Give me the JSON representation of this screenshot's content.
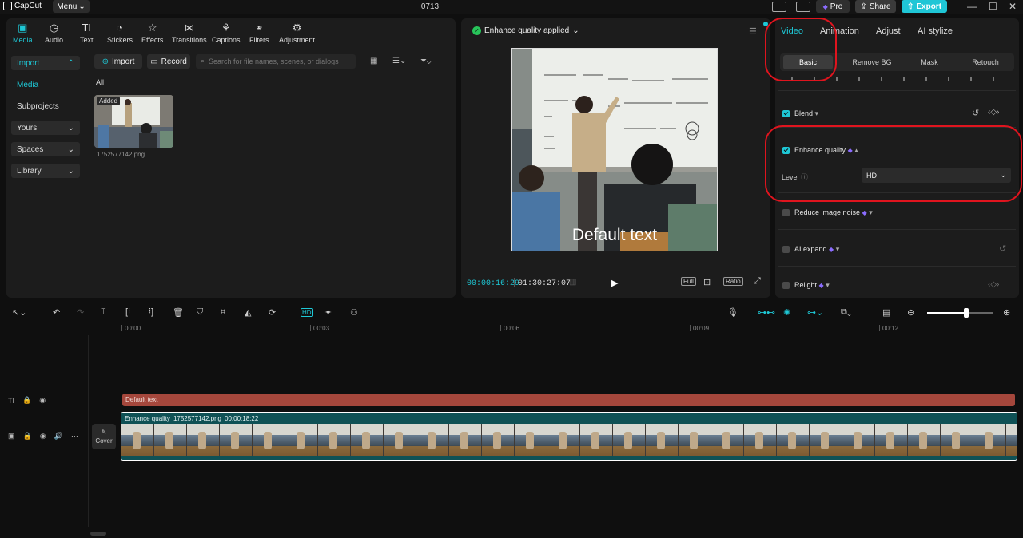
{
  "app": {
    "logo": "CapCut",
    "menu_label": "Menu",
    "project_title": "0713"
  },
  "titlebar": {
    "pro_label": "Pro",
    "share_label": "Share",
    "export_label": "Export"
  },
  "toolbar_tabs": [
    {
      "label": "Media"
    },
    {
      "label": "Audio"
    },
    {
      "label": "Text"
    },
    {
      "label": "Stickers"
    },
    {
      "label": "Effects"
    },
    {
      "label": "Transitions"
    },
    {
      "label": "Captions"
    },
    {
      "label": "Filters"
    },
    {
      "label": "Adjustment"
    }
  ],
  "sidebar": {
    "items": [
      {
        "label": "Import"
      },
      {
        "label": "Media"
      },
      {
        "label": "Subprojects"
      },
      {
        "label": "Yours"
      },
      {
        "label": "Spaces"
      },
      {
        "label": "Library"
      }
    ]
  },
  "media": {
    "import_label": "Import",
    "record_label": "Record",
    "search_placeholder": "Search for file names, scenes, or dialogs",
    "filter_label": "All",
    "item": {
      "badge": "Added",
      "filename": "1752577142.png"
    }
  },
  "player": {
    "status": "Enhance quality applied",
    "overlay_text": "Default text",
    "current_time": "00:00:16:29",
    "total_time": "01:30:27:07",
    "full_label": "Full",
    "ratio_label": "Ratio"
  },
  "inspector": {
    "tabs": [
      {
        "label": "Video"
      },
      {
        "label": "Animation"
      },
      {
        "label": "Adjust"
      },
      {
        "label": "AI stylize"
      }
    ],
    "subtabs": [
      {
        "label": "Basic"
      },
      {
        "label": "Remove BG"
      },
      {
        "label": "Mask"
      },
      {
        "label": "Retouch"
      }
    ],
    "blend_label": "Blend",
    "enhance_label": "Enhance quality",
    "level_label": "Level",
    "level_value": "HD",
    "noise_label": "Reduce image noise",
    "expand_label": "AI expand",
    "relight_label": "Relight"
  },
  "timeline": {
    "ruler": [
      "00:00",
      "00:03",
      "00:06",
      "00:09",
      "00:12"
    ],
    "text_clip": "Default text",
    "video_clip": {
      "effect": "Enhance quality",
      "filename": "1752577142.png",
      "duration": "00:00:18:22"
    },
    "cover_label": "Cover"
  },
  "colors": {
    "accent": "#1ec8d6",
    "highlight": "#e0141e",
    "text_clip": "#a5473c",
    "video_clip": "#0f5155"
  }
}
